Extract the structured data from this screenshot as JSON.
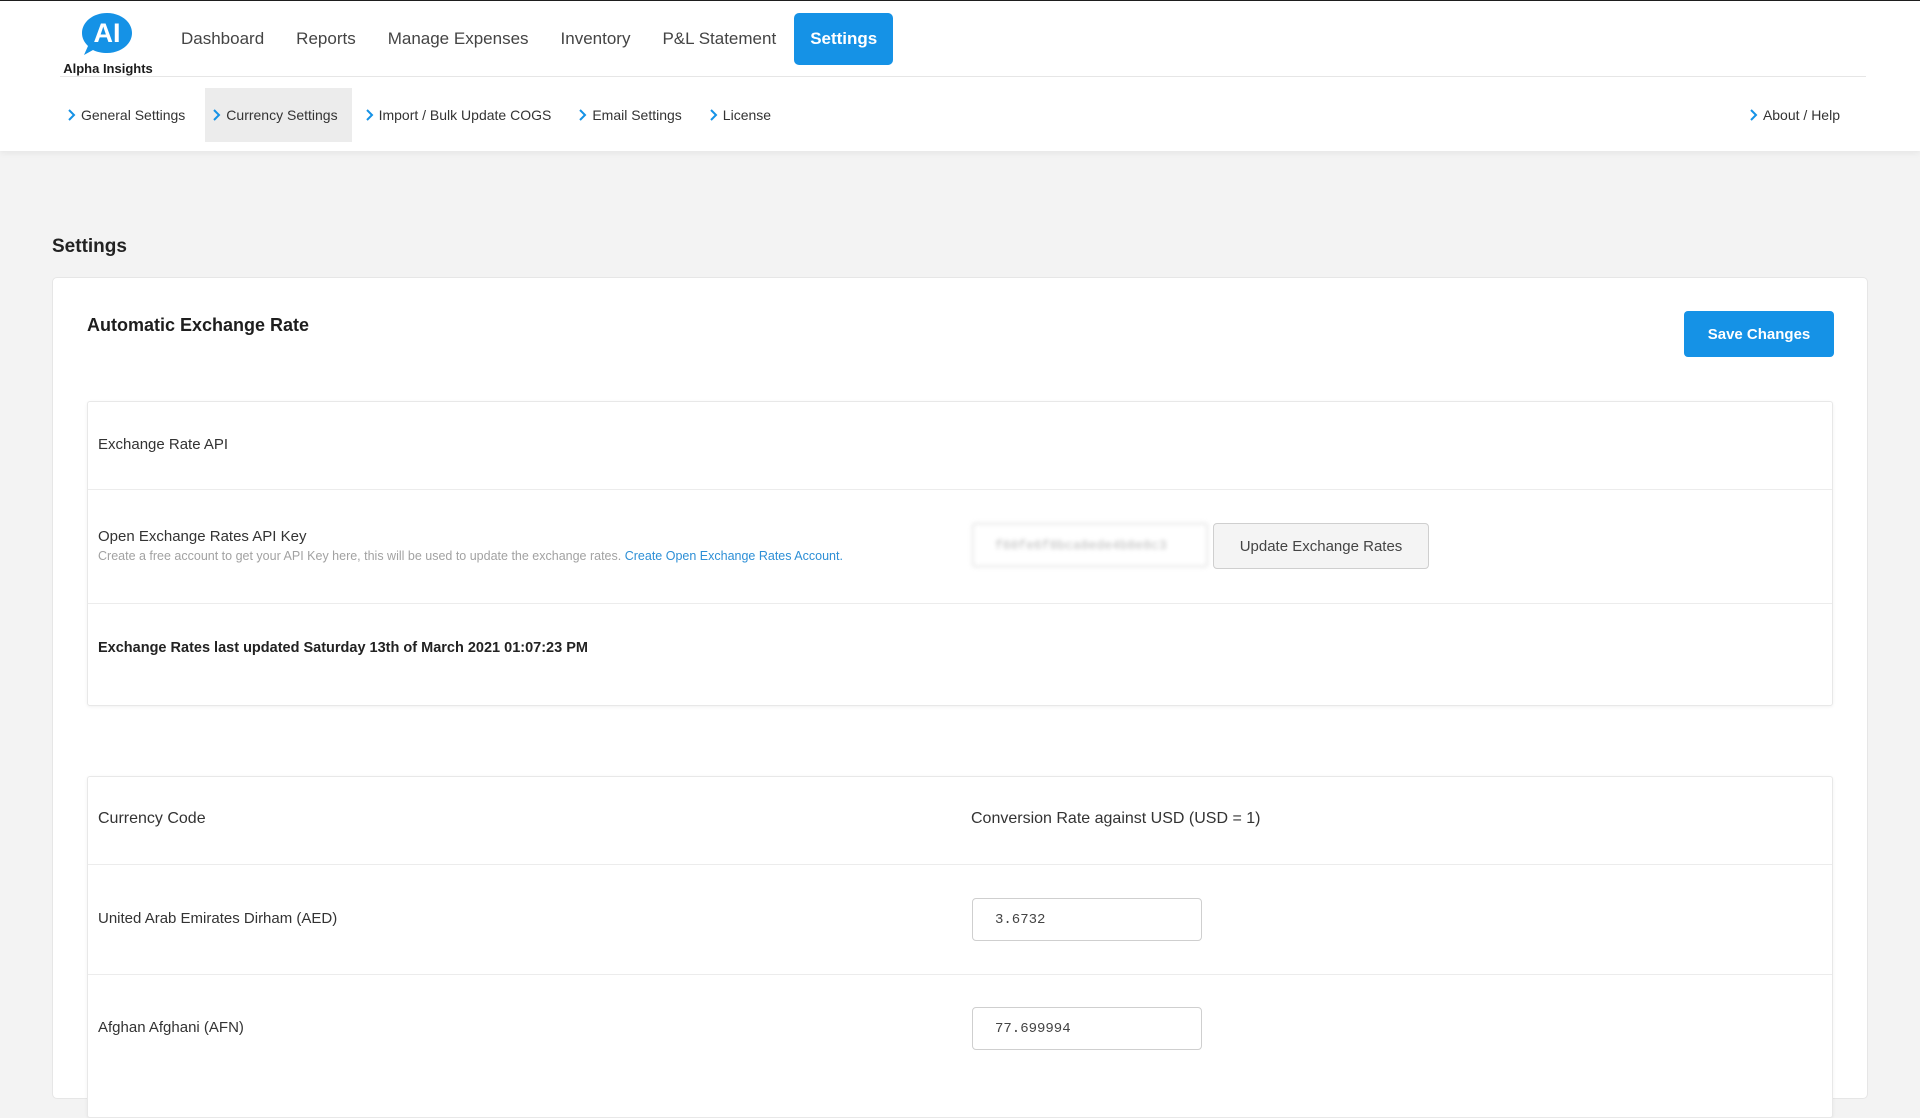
{
  "brand": {
    "logo_letters": "AI",
    "name": "Alpha Insights",
    "color": "#1592e6"
  },
  "main_nav": [
    {
      "label": "Dashboard"
    },
    {
      "label": "Reports"
    },
    {
      "label": "Manage Expenses"
    },
    {
      "label": "Inventory"
    },
    {
      "label": "P&L Statement"
    },
    {
      "label": "Settings",
      "active": true
    }
  ],
  "sub_nav": [
    {
      "label": "General Settings"
    },
    {
      "label": "Currency Settings",
      "active": true
    },
    {
      "label": "Import / Bulk Update COGS"
    },
    {
      "label": "Email Settings"
    },
    {
      "label": "License"
    }
  ],
  "sub_nav_right": {
    "label": "About / Help"
  },
  "page": {
    "title": "Settings"
  },
  "section": {
    "title": "Automatic Exchange Rate",
    "save_label": "Save Changes"
  },
  "api_panel": {
    "heading": "Exchange Rate API",
    "key_label": "Open Exchange Rates API Key",
    "help_text": "Create a free account to get your API Key here, this will be used to update the exchange rates.",
    "help_link": "Create Open Exchange Rates Account.",
    "api_key_value": "f60fe6f8bca8ede4b8e8c3",
    "update_label": "Update Exchange Rates",
    "last_updated": "Exchange Rates last updated Saturday 13th of March 2021 01:07:23 PM"
  },
  "currency_table": {
    "headers": [
      "Currency Code",
      "Conversion Rate against USD (USD = 1)"
    ],
    "rows": [
      {
        "name": "United Arab Emirates Dirham (AED)",
        "rate": "3.6732"
      },
      {
        "name": "Afghan Afghani (AFN)",
        "rate": "77.699994"
      }
    ]
  },
  "icons": {
    "chevron": "chevron-right-icon"
  }
}
